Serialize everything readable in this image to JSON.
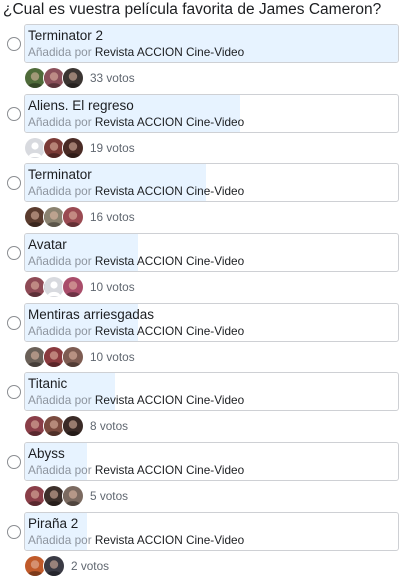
{
  "poll": {
    "question": "¿Cual es vuestra película favorita de James Cameron?",
    "added_prefix": "Añadida por",
    "colors": {
      "fill": "#e7f3ff",
      "border": "#ced0d4",
      "radio": "#8a8d91"
    },
    "options": [
      {
        "title": "Terminator 2",
        "author": "Revista ACCION Cine-Video",
        "votes_label": "33 votos",
        "votes": 33,
        "share": 1.0,
        "avatars": [
          {
            "icon": "avatar-photo",
            "color": "#4f6b3a"
          },
          {
            "icon": "avatar-photo",
            "color": "#8a4f5a"
          },
          {
            "icon": "avatar-photo",
            "color": "#3b3532"
          }
        ]
      },
      {
        "title": "Aliens. El regreso",
        "author": "Revista ACCION Cine-Video",
        "votes_label": "19 votos",
        "votes": 19,
        "share": 0.576,
        "avatars": [
          {
            "icon": "default-avatar",
            "color": "#d8dadf"
          },
          {
            "icon": "avatar-photo",
            "color": "#7a3a36"
          },
          {
            "icon": "avatar-photo",
            "color": "#4a2b25"
          }
        ]
      },
      {
        "title": "Terminator",
        "author": "Revista ACCION Cine-Video",
        "votes_label": "16 votos",
        "votes": 16,
        "share": 0.485,
        "avatars": [
          {
            "icon": "avatar-photo",
            "color": "#5a3b2e"
          },
          {
            "icon": "avatar-photo",
            "color": "#8a8270"
          },
          {
            "icon": "avatar-photo",
            "color": "#9a4a52"
          }
        ]
      },
      {
        "title": "Avatar",
        "author": "Revista ACCION Cine-Video",
        "votes_label": "10 votos",
        "votes": 10,
        "share": 0.303,
        "avatars": [
          {
            "icon": "avatar-photo",
            "color": "#8e4a55"
          },
          {
            "icon": "default-avatar",
            "color": "#d8dadf"
          },
          {
            "icon": "avatar-photo",
            "color": "#a94d6a"
          }
        ]
      },
      {
        "title": "Mentiras arriesgadas",
        "author": "Revista ACCION Cine-Video",
        "votes_label": "10 votos",
        "votes": 10,
        "share": 0.303,
        "avatars": [
          {
            "icon": "avatar-photo",
            "color": "#6a6058"
          },
          {
            "icon": "avatar-photo",
            "color": "#8a3a3e"
          },
          {
            "icon": "avatar-photo",
            "color": "#7e5c52"
          }
        ]
      },
      {
        "title": "Titanic",
        "author": "Revista ACCION Cine-Video",
        "votes_label": "8 votos",
        "votes": 8,
        "share": 0.242,
        "avatars": [
          {
            "icon": "avatar-photo",
            "color": "#8a3e48"
          },
          {
            "icon": "avatar-photo",
            "color": "#7a4a3e"
          },
          {
            "icon": "avatar-photo",
            "color": "#3a2a26"
          }
        ]
      },
      {
        "title": "Abyss",
        "author": "Revista ACCION Cine-Video",
        "votes_label": "5 votos",
        "votes": 5,
        "share": 0.152,
        "avatars": [
          {
            "icon": "avatar-photo",
            "color": "#8a3e48"
          },
          {
            "icon": "avatar-photo",
            "color": "#3c2f2a"
          },
          {
            "icon": "avatar-photo",
            "color": "#7b6a60"
          }
        ]
      },
      {
        "title": "Piraña 2",
        "author": "Revista ACCION Cine-Video",
        "votes_label": "2 votos",
        "votes": 2,
        "share": 0.061,
        "avatars": [
          {
            "icon": "avatar-photo",
            "color": "#c05a2a"
          },
          {
            "icon": "avatar-photo",
            "color": "#3a3a44"
          }
        ]
      }
    ]
  }
}
